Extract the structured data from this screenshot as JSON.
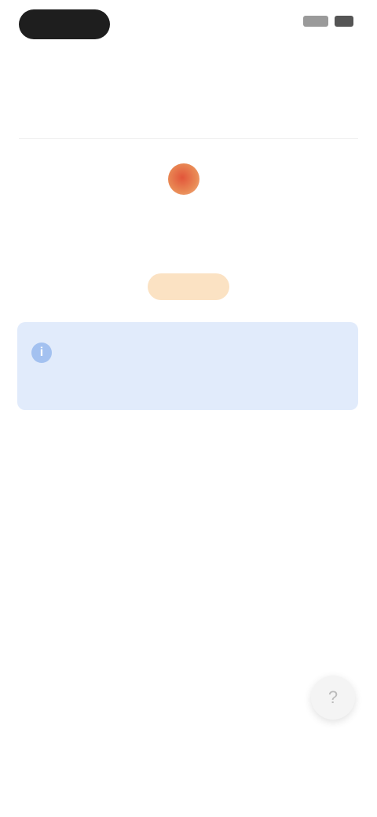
{
  "status_bar": {
    "time": "",
    "signal_icon": "signal-icon",
    "battery_icon": "battery-icon"
  },
  "header": {
    "title": "",
    "subtitle": ""
  },
  "tabs": [
    {
      "label": "",
      "active": true
    },
    {
      "label": "",
      "active": false
    }
  ],
  "brand": {
    "logo_icon": "brand-logo-icon",
    "name": ""
  },
  "tagline": "",
  "cta": {
    "label": ""
  },
  "info_card": {
    "icon": "info-icon",
    "text": ""
  },
  "fab": {
    "icon": "help-icon"
  },
  "colors": {
    "accent": "#f19c32",
    "info_bg": "#e1ebfb",
    "info_text": "#5d7fb8",
    "logo": "#e2553a"
  }
}
